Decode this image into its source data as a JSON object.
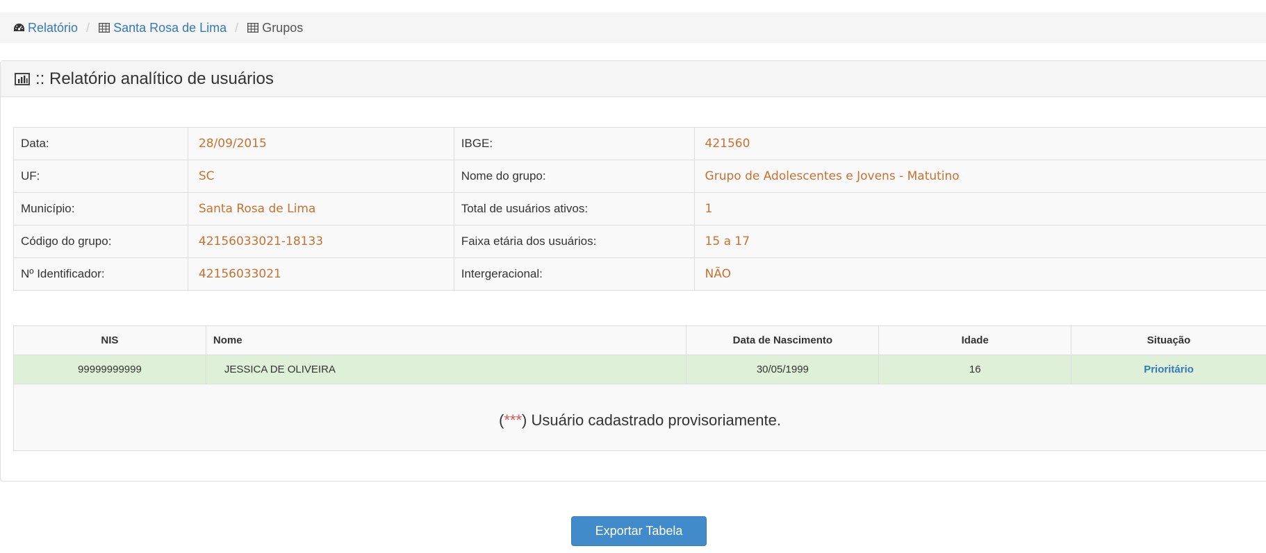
{
  "breadcrumb": {
    "items": [
      {
        "label": "Relatório",
        "icon": "dashboard-icon",
        "link": true
      },
      {
        "label": "Santa Rosa de Lima",
        "icon": "table-icon",
        "link": true
      },
      {
        "label": "Grupos",
        "icon": "table-icon",
        "link": false
      }
    ]
  },
  "panel": {
    "title": ":: Relatório analítico de usuários",
    "icon": "bar-chart-icon"
  },
  "info": {
    "rows": [
      {
        "label1": "Data:",
        "value1": "28/09/2015",
        "label2": "IBGE:",
        "value2": "421560"
      },
      {
        "label1": "UF:",
        "value1": "SC",
        "label2": "Nome do grupo:",
        "value2": "Grupo de Adolescentes e Jovens - Matutino"
      },
      {
        "label1": "Município:",
        "value1": "Santa Rosa de Lima",
        "label2": "Total de usuários ativos:",
        "value2": "1"
      },
      {
        "label1": "Código do grupo:",
        "value1": "42156033021-18133",
        "label2": "Faixa etária dos usuários:",
        "value2": "15 a 17"
      },
      {
        "label1": "Nº Identificador:",
        "value1": "42156033021",
        "label2": "Intergeracional:",
        "value2": "NÃO"
      }
    ]
  },
  "users": {
    "headers": [
      "NIS",
      "Nome",
      "Data de Nascimento",
      "Idade",
      "Situação"
    ],
    "rows": [
      {
        "nis": "99999999999",
        "nome": "JESSICA DE OLIVEIRA",
        "nascimento": "30/05/1999",
        "idade": "16",
        "situacao": "Prioritário"
      }
    ],
    "note_open": "(",
    "note_stars": "***",
    "note_text": ") Usuário cadastrado provisoriamente."
  },
  "export_button": "Exportar Tabela",
  "colors": {
    "link": "#337ab7",
    "value": "#c8702e",
    "row_success": "#dff0d8",
    "button": "#428bca",
    "stars": "#d9534f"
  }
}
